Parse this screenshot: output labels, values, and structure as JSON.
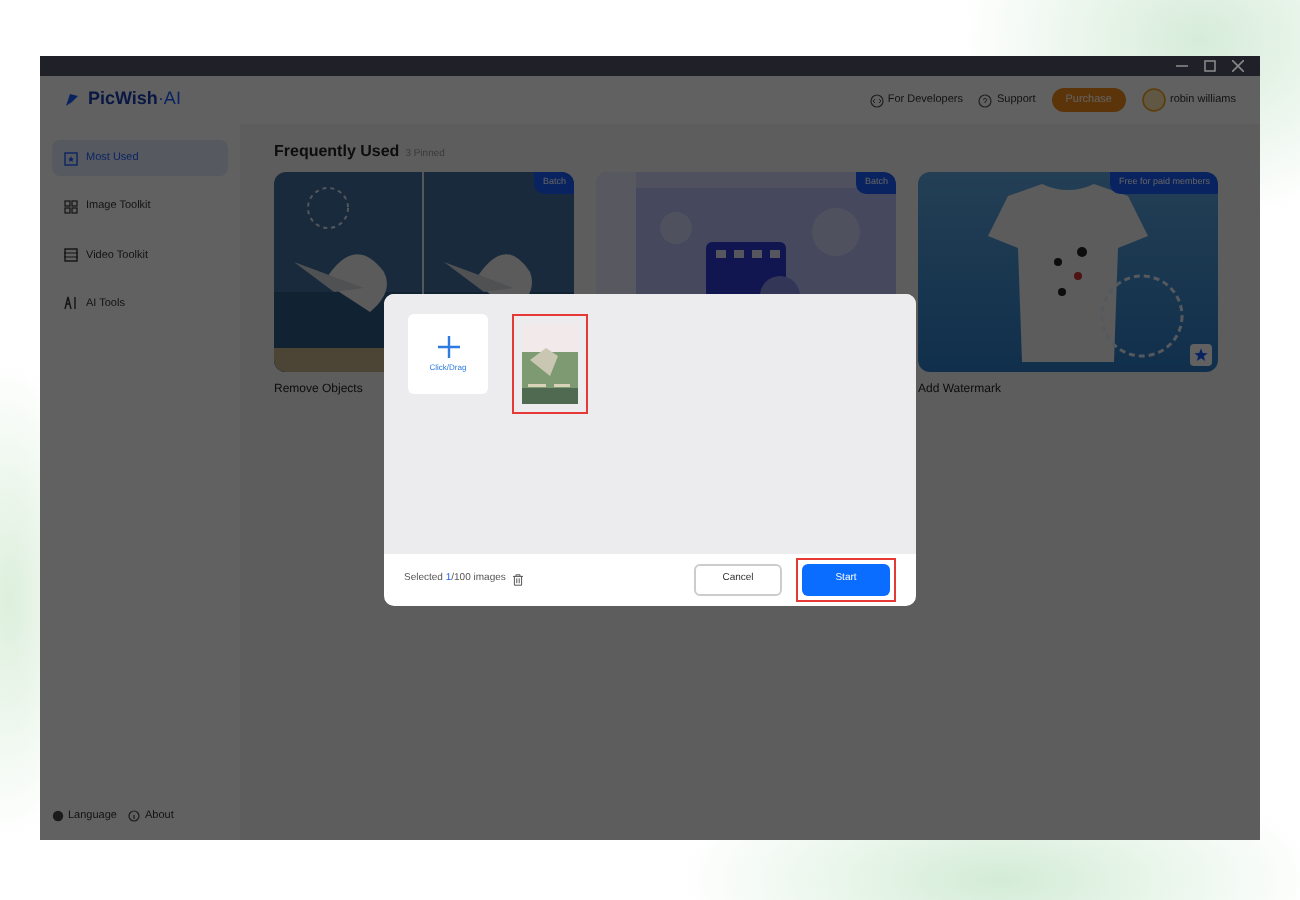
{
  "header": {
    "logo": "**PicWish**·AI",
    "links": [
      "For Developers",
      "Support"
    ],
    "purchase": "Purchase",
    "user": "robin williams"
  },
  "sidebar": {
    "items": [
      {
        "label": "Most Used",
        "selected": true
      },
      {
        "label": "Image Toolkit",
        "selected": false
      },
      {
        "label": "Video Toolkit",
        "selected": false
      },
      {
        "label": "AI Tools",
        "selected": false
      }
    ],
    "footer": [
      "Language",
      "About"
    ]
  },
  "main": {
    "title": "Frequently Used",
    "subtitle": "3 Pinned",
    "cards": [
      {
        "tag": "Batch",
        "label": "Remove Objects"
      },
      {
        "tag": "Batch"
      },
      {
        "tag": "Free for paid members",
        "label": "Add Watermark",
        "pinned": true
      }
    ]
  },
  "dialog": {
    "add_label": "Click/Drag",
    "thumbnails": [
      {
        "selected": true
      }
    ],
    "status": {
      "prefix": "Selected ",
      "count": "1",
      "suffix": "/100 images"
    },
    "buttons": [
      {
        "label": "Cancel",
        "kind": "secondary",
        "highlighted": false
      },
      {
        "label": "Start",
        "kind": "primary",
        "highlighted": true
      }
    ]
  }
}
